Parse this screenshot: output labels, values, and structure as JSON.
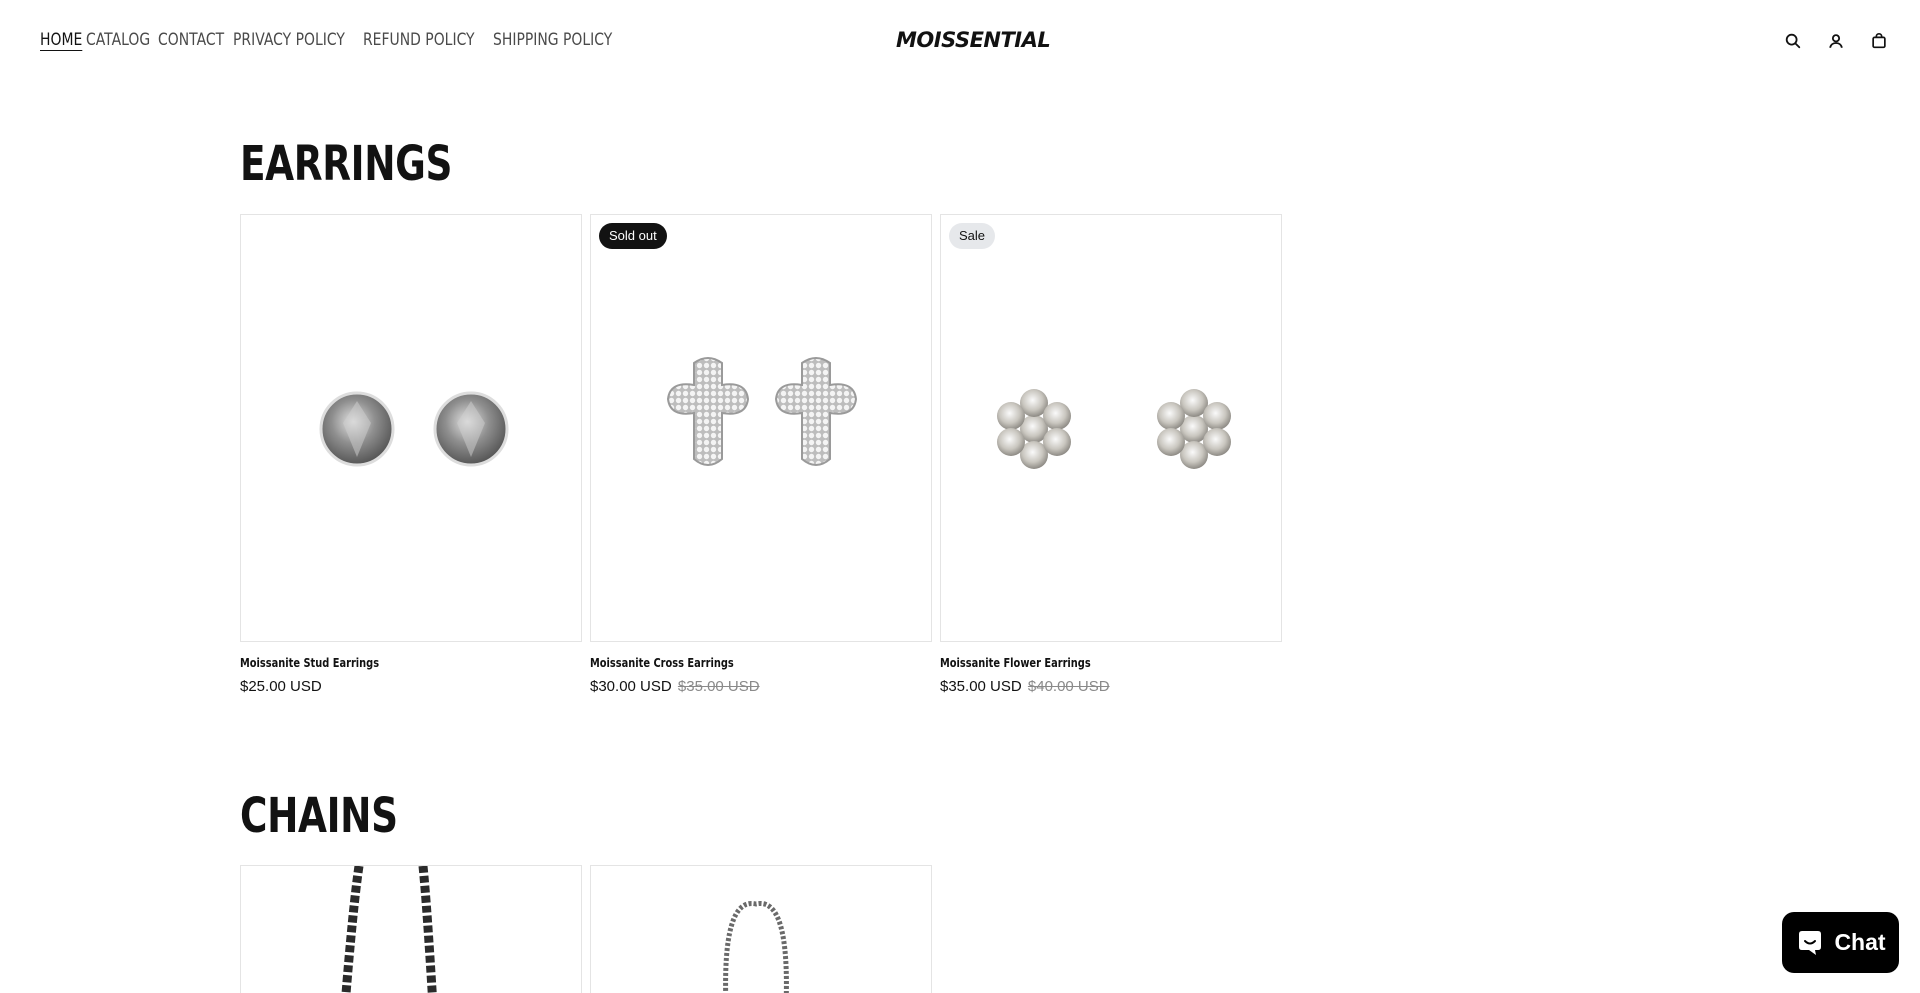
{
  "header": {
    "nav": [
      "HOME",
      "CATALOG",
      "CONTACT",
      "PRIVACY POLICY",
      "REFUND POLICY",
      "SHIPPING POLICY"
    ],
    "logo": "MOISSENTIAL",
    "icons": [
      "search-icon",
      "account-icon",
      "cart-icon"
    ]
  },
  "sections": [
    {
      "title": "EARRINGS",
      "products": [
        {
          "title": "Moissanite Stud Earrings",
          "price": "$25.00 USD",
          "compare": "",
          "badge": ""
        },
        {
          "title": "Moissanite Cross Earrings",
          "price": "$30.00 USD",
          "compare": "$35.00 USD",
          "badge": "Sold out"
        },
        {
          "title": "Moissanite Flower Earrings",
          "price": "$35.00 USD",
          "compare": "$40.00 USD",
          "badge": "Sale"
        }
      ]
    },
    {
      "title": "CHAINS",
      "products": []
    }
  ],
  "chat": {
    "label": "Chat"
  },
  "colors": {
    "text": "#121212",
    "badge_dark": "#121212",
    "badge_light": "#e6e8eb",
    "chat_bg": "#000000"
  }
}
